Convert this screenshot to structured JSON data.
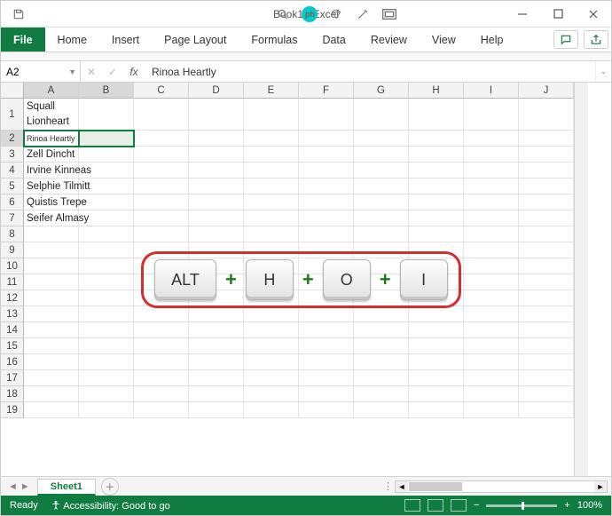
{
  "titlebar": {
    "title": "Book1 - Excel"
  },
  "ribbon": {
    "tabs": [
      "File",
      "Home",
      "Insert",
      "Page Layout",
      "Formulas",
      "Data",
      "Review",
      "View",
      "Help"
    ]
  },
  "formula_bar": {
    "namebox": "A2",
    "fx_label": "fx",
    "value": "Rinoa Heartly"
  },
  "columns": [
    "A",
    "B",
    "C",
    "D",
    "E",
    "F",
    "G",
    "H",
    "I",
    "J"
  ],
  "row_count": 19,
  "cells": {
    "A1": "Squall Lionheart",
    "A2": "Rinoa Heartly",
    "A3": "Zell Dincht",
    "A4": "Irvine Kinneas",
    "A5": "Selphie Tilmitt",
    "A6": "Quistis Trepe",
    "A7": "Seifer Almasy"
  },
  "row1_display_a": "Squall",
  "row1_display_b_overflow": "Lionheart",
  "selection": {
    "active": "A2",
    "range": "A2:B2"
  },
  "shortcut": {
    "keys": [
      "ALT",
      "H",
      "O",
      "I"
    ],
    "sep": "+"
  },
  "sheets": {
    "active": "Sheet1"
  },
  "statusbar": {
    "state": "Ready",
    "accessibility": "Accessibility: Good to go",
    "zoom": "100%",
    "minus": "−",
    "plus": "+"
  }
}
